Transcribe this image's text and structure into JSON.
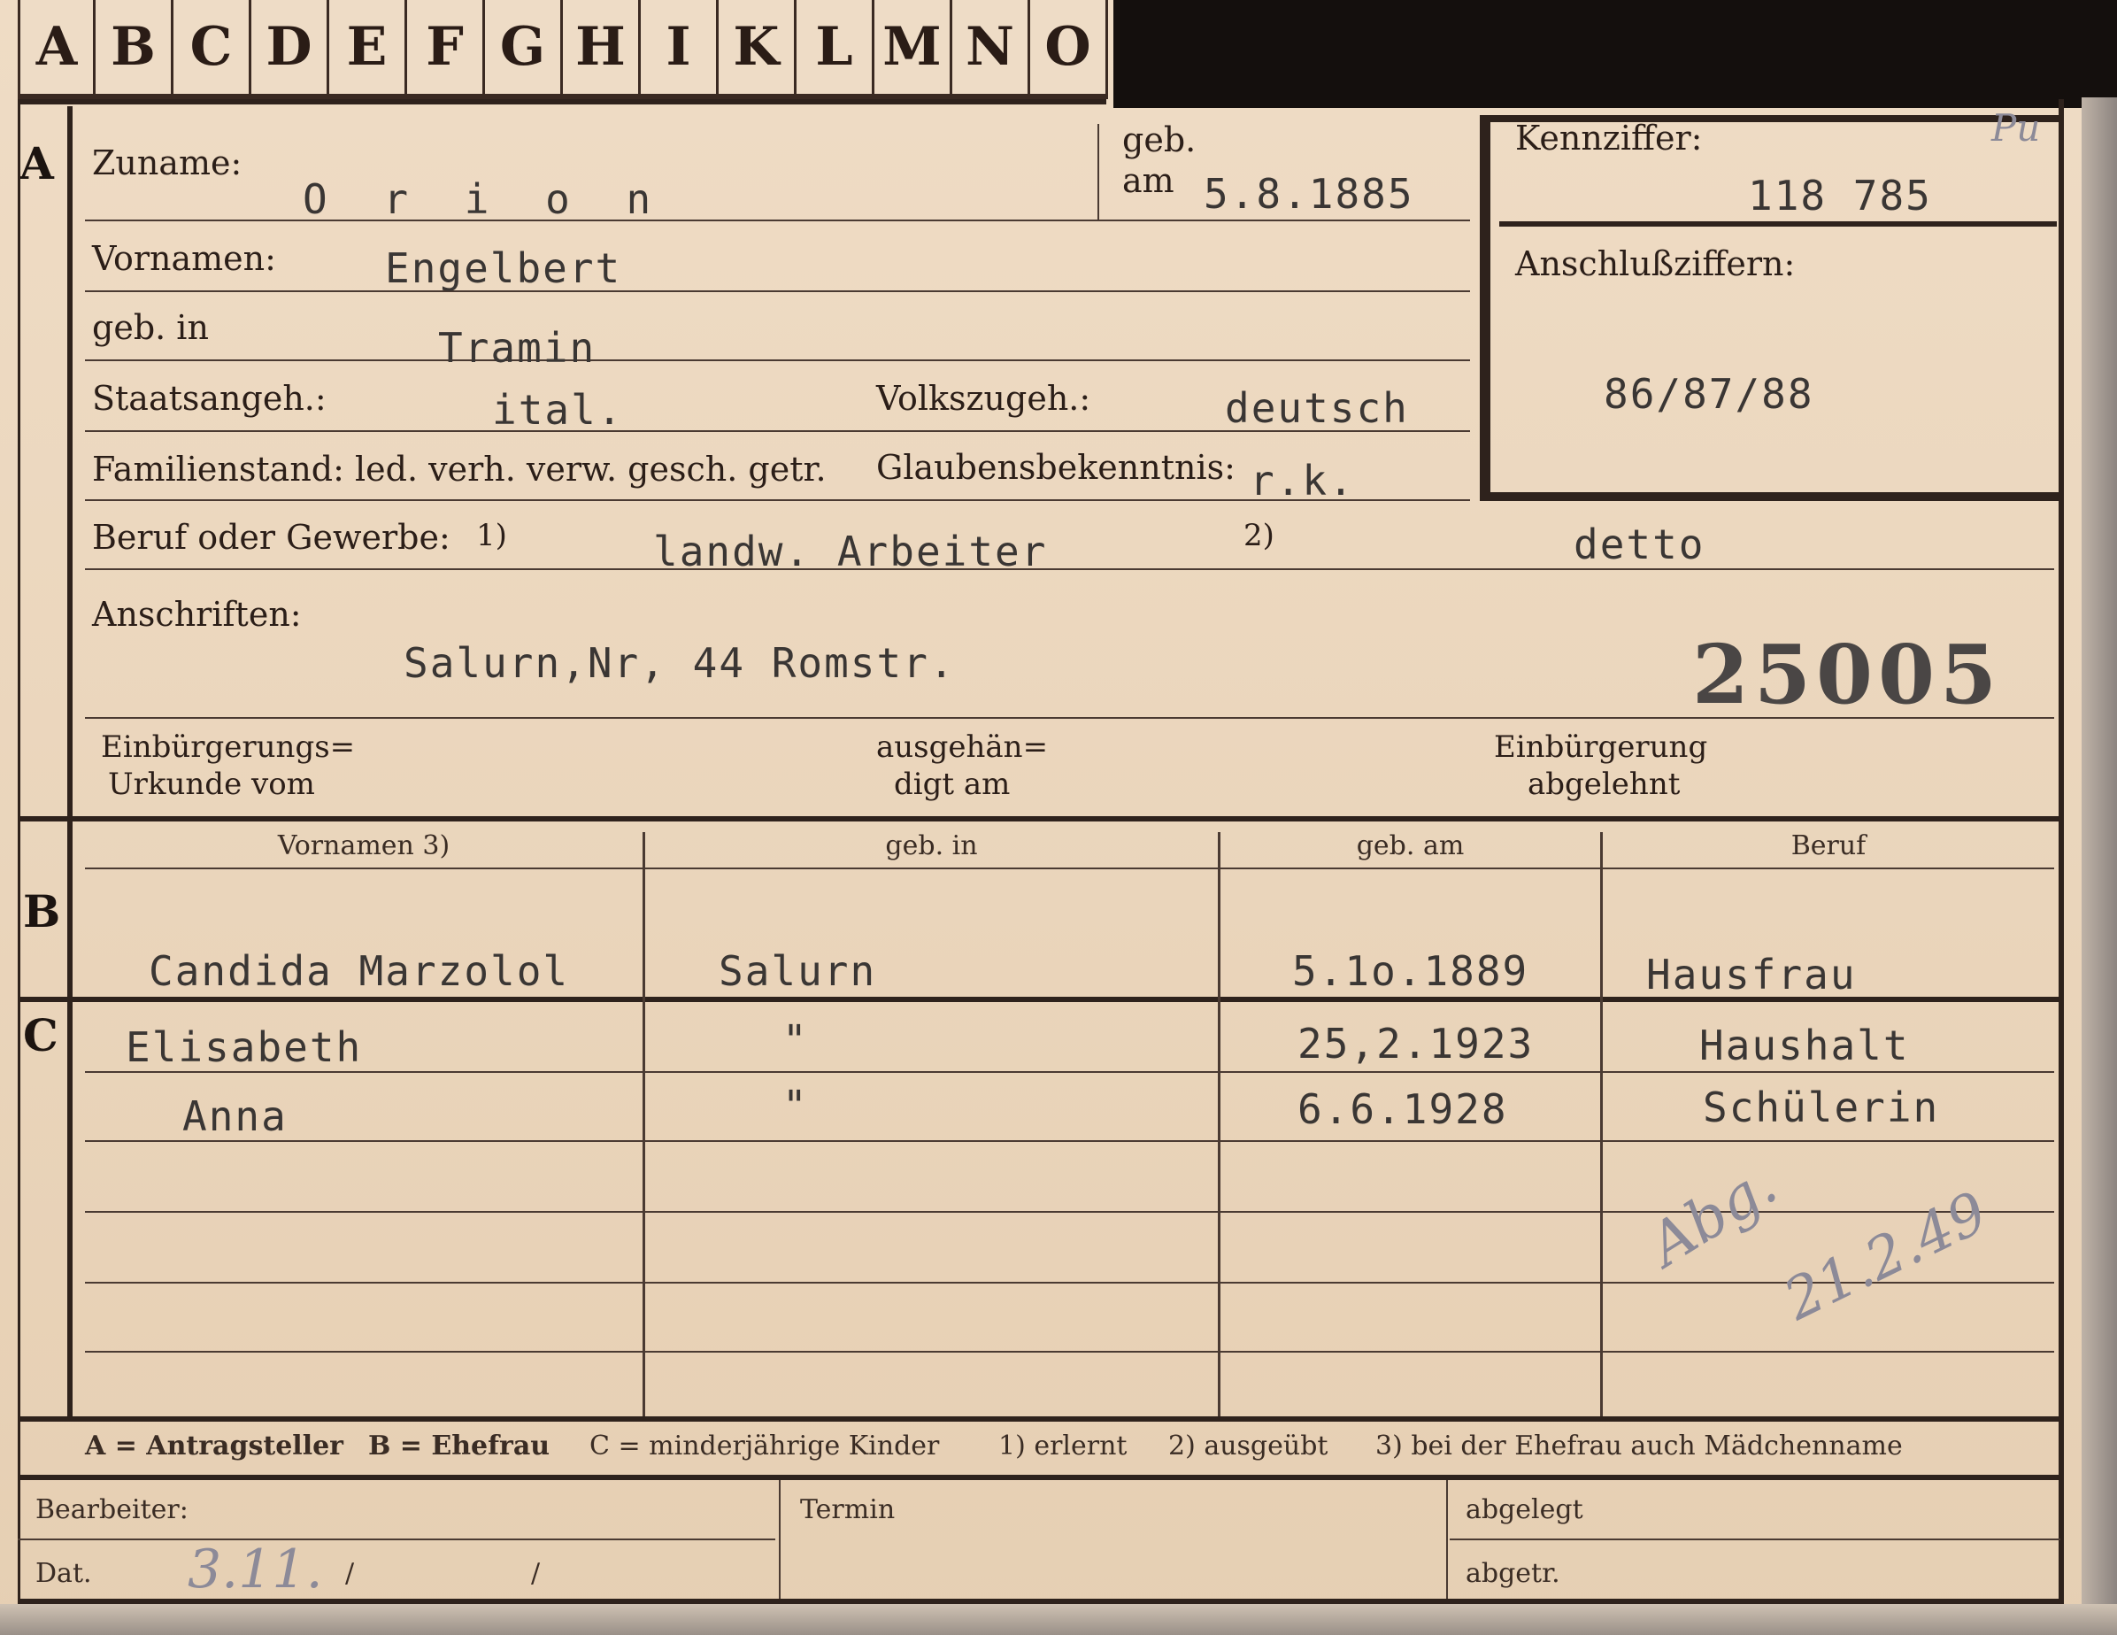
{
  "tabs": [
    "A",
    "B",
    "C",
    "D",
    "E",
    "F",
    "G",
    "H",
    "I",
    "K",
    "L",
    "M",
    "N",
    "O"
  ],
  "section_letters": {
    "a": "A",
    "b": "B",
    "c": "C"
  },
  "section_a": {
    "zuname_label": "Zuname:",
    "zuname_value": "O r i o n",
    "geb_label": "geb.",
    "am_label": "am",
    "geb_am_value": "5.8.1885",
    "kennziffer_label": "Kennziffer:",
    "kennziffer_mark": "Pu",
    "kennziffer_value": "118 785",
    "anschluss_label": "Anschlußziffern:",
    "anschluss_value": "86/87/88",
    "vornamen_label": "Vornamen:",
    "vornamen_value": "Engelbert",
    "geb_in_label": "geb. in",
    "geb_in_value": "Tramin",
    "staats_label": "Staatsangeh.:",
    "staats_value": "ital.",
    "volks_label": "Volkszugeh.:",
    "volks_value": "deutsch",
    "familien_label": "Familienstand: led. verh. verw. gesch. getr.",
    "glaubens_label": "Glaubensbekenntnis:",
    "glaubens_value": "r.k.",
    "beruf_label": "Beruf oder Gewerbe:",
    "beruf_note1": "1)",
    "beruf_value1": "landw. Arbeiter",
    "beruf_note2": "2)",
    "beruf_value2": "detto",
    "anschriften_label": "Anschriften:",
    "anschriften_value": "Salurn,Nr, 44 Romstr.",
    "number": "25005",
    "einb_urkunde_label_1": "Einbürgerungs=",
    "einb_urkunde_label_2": "Urkunde vom",
    "ausgeh_label_1": "ausgehän=",
    "ausgeh_label_2": "digt am",
    "einb_abgelehnt_label_1": "Einbürgerung",
    "einb_abgelehnt_label_2": "abgelehnt"
  },
  "section_b": {
    "headers": {
      "vornamen": "Vornamen 3)",
      "geb_in": "geb. in",
      "geb_am": "geb. am",
      "beruf": "Beruf"
    },
    "row": {
      "vornamen": "Candida Marzolol",
      "geb_in": "Salurn",
      "geb_am": "5.1o.1889",
      "beruf": "Hausfrau"
    }
  },
  "section_c": {
    "rows": [
      {
        "vornamen": "Elisabeth",
        "geb_in": "\"",
        "geb_am": "25,2.1923",
        "beruf": "Haushalt"
      },
      {
        "vornamen": "Anna",
        "geb_in": "\"",
        "geb_am": "6.6.1928",
        "beruf": "Schülerin"
      }
    ],
    "handwritten_1": "Abg.",
    "handwritten_2": "21.2.49"
  },
  "legend": {
    "a": "A = Antragsteller",
    "b": "B = Ehefrau",
    "c": "C = minderjährige Kinder",
    "n1": "1) erlernt",
    "n2": "2) ausgeübt",
    "n3": "3) bei der Ehefrau auch Mädchenname"
  },
  "footer": {
    "bearbeiter_label": "Bearbeiter:",
    "termin_label": "Termin",
    "abgelegt_label": "abgelegt",
    "dat_label": "Dat.",
    "dat_hand": "3.11.",
    "dat_slash1": "/",
    "dat_slash2": "/",
    "abgetr_label": "abgetr."
  }
}
